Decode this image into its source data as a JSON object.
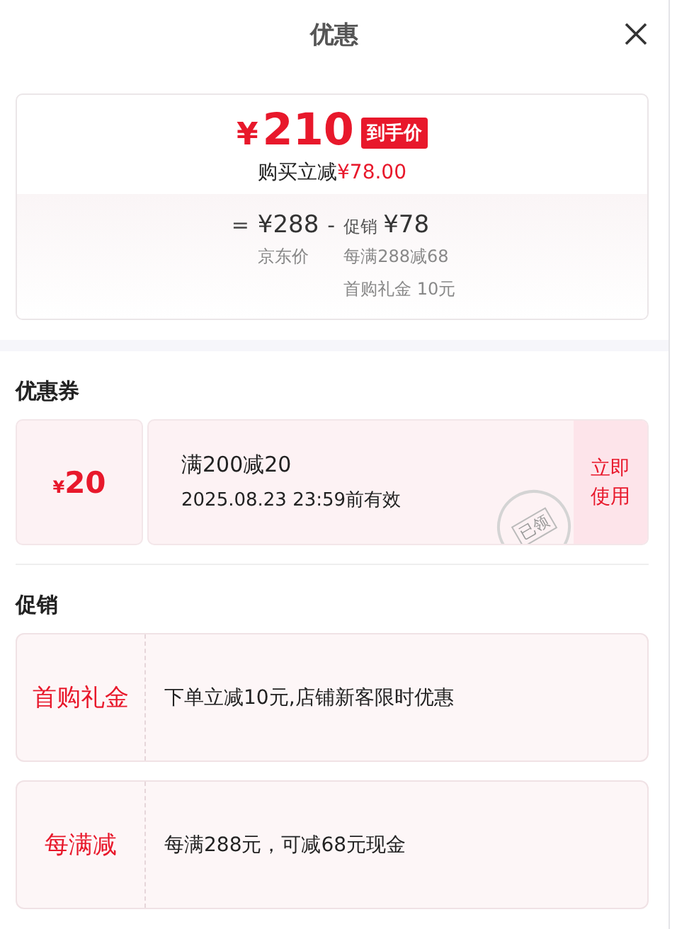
{
  "header": {
    "title": "优惠"
  },
  "summary": {
    "price_symbol": "¥",
    "price": "210",
    "price_tag": "到手价",
    "saving_label": "购买立减",
    "saving": "¥78.00",
    "breakdown": {
      "equals": "=",
      "base_price": "¥288",
      "base_label": "京东价",
      "minus": "-",
      "discount_label": "促销",
      "discount": "¥78",
      "discount_items": [
        "每满288减68",
        "首购礼金 10元"
      ]
    }
  },
  "coupons": {
    "heading": "优惠券",
    "items": [
      {
        "amount_symbol": "¥",
        "amount": "20",
        "condition": "满200减20",
        "validity": "2025.08.23 23:59前有效",
        "claimed": true,
        "stamp": "已领",
        "action": "立即使用"
      }
    ]
  },
  "promotions": {
    "heading": "促销",
    "items": [
      {
        "label": "首购礼金",
        "description": "下单立减10元,店铺新客限时优惠"
      },
      {
        "label": "每满减",
        "description": "每满288元，可减68元现金"
      }
    ]
  }
}
